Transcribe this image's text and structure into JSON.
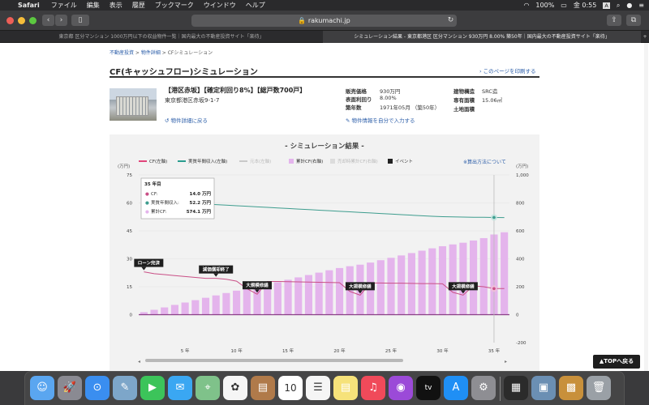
{
  "menubar": {
    "app": "Safari",
    "items": [
      "ファイル",
      "編集",
      "表示",
      "履歴",
      "ブックマーク",
      "ウインドウ",
      "ヘルプ"
    ],
    "battery": "100%",
    "clock": "金 0:55",
    "input_source": "A"
  },
  "browser": {
    "url": "rakumachi.jp",
    "tabs": [
      {
        "title": "東京都 区分マンション 1000万円以下の収益物件一覧｜国内最大の不動産投資サイト「楽待」",
        "active": false
      },
      {
        "title": "シミュレーション結果 - 東京都港区 区分マンション 930万円 8.00% 築50年｜国内最大の不動産投資サイト「楽待」",
        "active": true
      }
    ]
  },
  "breadcrumb": {
    "items": [
      "不動産投資",
      "物件詳細",
      "CFシミュレーション"
    ],
    "sep": " > "
  },
  "page_title": "CF(キャッシュフロー)シミュレーション",
  "print_link": "› このページを印刷する",
  "property": {
    "tags": "【港区赤坂】【確定利回り8%】【総戸数700戸】",
    "address": "東京都港区赤坂9-1-7",
    "back_link": "物件詳細に戻る",
    "input_link": "物件情報を自分で入力する",
    "info": [
      {
        "label": "販売価格",
        "value": "930万円"
      },
      {
        "label": "表面利回り",
        "value": "8.00%"
      },
      {
        "label": "築年数",
        "value": "1971年05月 （築50年）"
      },
      {
        "label": "建物構造",
        "value": "SRC造"
      },
      {
        "label": "専有面積",
        "value": "15.06㎡"
      },
      {
        "label": "土地面積",
        "value": ""
      }
    ]
  },
  "simulation": {
    "title": "- シミュレーション結果 -",
    "legend": [
      {
        "label": "CF(左軸)",
        "color": "#e0447a",
        "kind": "line",
        "active": true
      },
      {
        "label": "実質年間収入(左軸)",
        "color": "#2a9d8f",
        "kind": "line",
        "active": true
      },
      {
        "label": "元本(左軸)",
        "color": "#c9c9c9",
        "kind": "line",
        "active": false
      },
      {
        "label": "累計CF(右軸)",
        "color": "#e4b4ec",
        "kind": "box",
        "active": true
      },
      {
        "label": "売却時累計CF(右軸)",
        "color": "#dcdcdc",
        "kind": "box",
        "active": false
      },
      {
        "label": "イベント",
        "color": "#222222",
        "kind": "box",
        "active": true
      }
    ],
    "calc_link": "※算出方法について"
  },
  "chart_data": {
    "type": "bar",
    "left_unit": "(万円)",
    "right_unit": "(万円)",
    "left_ylim": [
      -15,
      75
    ],
    "left_ticks": [
      75,
      60,
      45,
      30,
      15,
      0
    ],
    "right_ylim": [
      -200,
      1000
    ],
    "right_ticks": [
      1000,
      800,
      600,
      400,
      200,
      0,
      -200
    ],
    "x_ticks": [
      "5 年",
      "10 年",
      "15 年",
      "20 年",
      "25 年",
      "30 年",
      "35 年"
    ],
    "x_tick_values": [
      5,
      10,
      15,
      20,
      25,
      30,
      35
    ],
    "x_range": [
      1,
      36
    ],
    "x": [
      1,
      2,
      3,
      4,
      5,
      6,
      7,
      8,
      9,
      10,
      11,
      12,
      13,
      14,
      15,
      16,
      17,
      18,
      19,
      20,
      21,
      22,
      23,
      24,
      25,
      26,
      27,
      28,
      29,
      30,
      31,
      32,
      33,
      34,
      35,
      36
    ],
    "grid": true,
    "series": [
      {
        "name": "累計CF(右軸)",
        "axis": "right",
        "kind": "bar",
        "color": "#e4b4ec",
        "values": [
          18,
          35,
          52,
          70,
          87,
          104,
          121,
          138,
          155,
          172,
          187,
          200,
          215,
          232,
          250,
          267,
          284,
          301,
          318,
          334,
          347,
          358,
          373,
          390,
          407,
          424,
          441,
          458,
          475,
          490,
          503,
          515,
          531,
          548,
          574,
          590
        ]
      },
      {
        "name": "CF(左軸)",
        "axis": "left",
        "kind": "line",
        "color": "#c94f86",
        "values": [
          23,
          22,
          21.5,
          21,
          20.5,
          20,
          19.5,
          19.5,
          19,
          18,
          14,
          11,
          17.8,
          17.8,
          17.7,
          17.6,
          17.5,
          17.4,
          17.3,
          17.2,
          12.5,
          10.5,
          17,
          17,
          16.9,
          16.9,
          16.8,
          16.7,
          16.7,
          16.6,
          12,
          10.5,
          15.5,
          15,
          14,
          14
        ]
      },
      {
        "name": "実質年間収入(左軸)",
        "axis": "left",
        "kind": "line",
        "color": "#3e9d8e",
        "values": [
          61.2,
          60.9,
          60.6,
          60.3,
          60,
          59.7,
          59.4,
          59.1,
          58.8,
          58.5,
          58.2,
          57.9,
          57.6,
          57.3,
          57,
          56.7,
          56.4,
          56.1,
          55.8,
          55.5,
          55.2,
          54.9,
          54.6,
          54.3,
          54,
          53.7,
          53.4,
          53.1,
          52.8,
          52.6,
          52.5,
          52.4,
          52.3,
          52.3,
          52.2,
          52.1
        ]
      }
    ],
    "events": [
      {
        "label": "ローン完済",
        "x": 1,
        "y": 23
      },
      {
        "label": "減価償却終了",
        "x": 8,
        "y": 19.5
      },
      {
        "label": "大規模修繕",
        "x": 12,
        "y": 11
      },
      {
        "label": "大規模修繕",
        "x": 22,
        "y": 10.5
      },
      {
        "label": "大規模修繕",
        "x": 32,
        "y": 10.5
      }
    ],
    "tooltip": {
      "year": "35 年目",
      "rows": [
        {
          "label": "CF:",
          "value": "14.0 万円",
          "color": "#c94f86"
        },
        {
          "label": "実質年間収入:",
          "value": "52.2 万円",
          "color": "#3e9d8e"
        },
        {
          "label": "累計CF:",
          "value": "574.1 万円",
          "color": "#e4b4ec"
        }
      ]
    },
    "highlight_x": 35
  },
  "top_button": "▲TOPへ戻る",
  "dock": {
    "apps": [
      "finder-icon",
      "launchpad-icon",
      "safari-icon",
      "preview-icon",
      "facetime-icon",
      "messages-icon",
      "maps-icon",
      "photos-icon",
      "contacts-icon",
      "calendar-icon",
      "reminders-icon",
      "notes-icon",
      "music-icon",
      "podcasts-icon",
      "tv-icon",
      "appstore-icon",
      "system-preferences-icon",
      "activity-monitor-icon",
      "preview-files-icon",
      "stack-icon",
      "trash-icon"
    ],
    "calendar_day": "10"
  }
}
